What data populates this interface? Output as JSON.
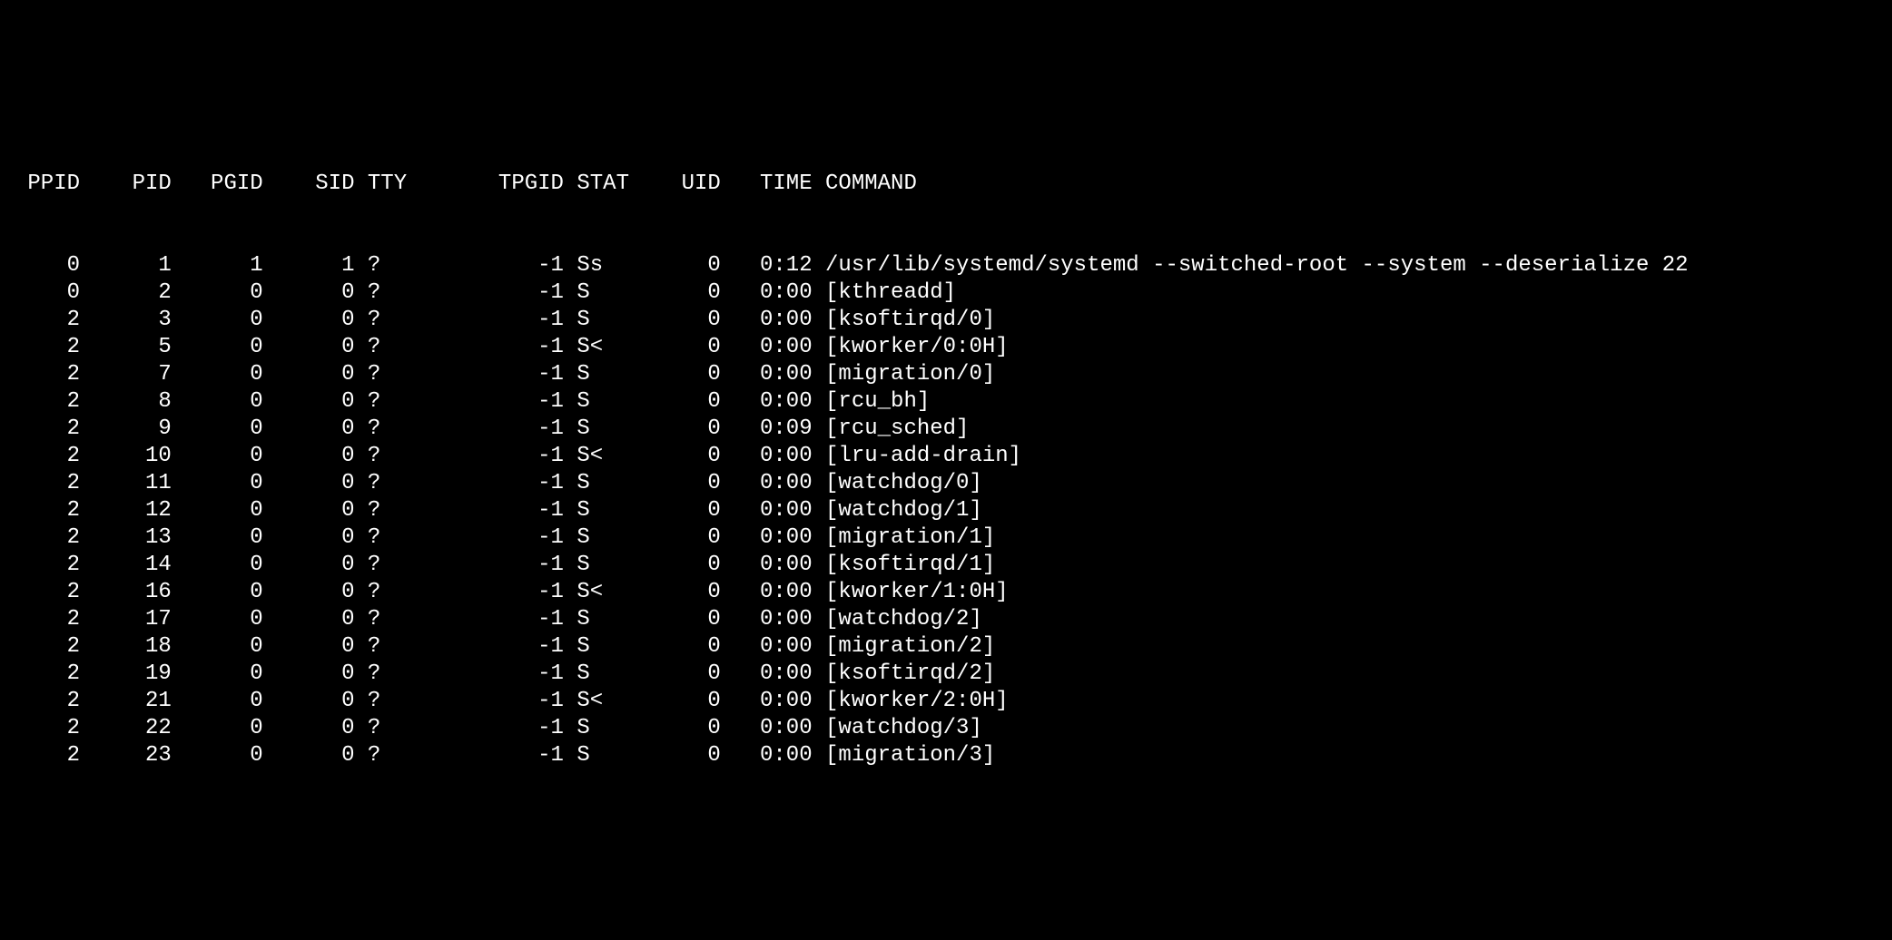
{
  "columns": {
    "ppid_w": 5,
    "pid_w": 7,
    "pgid_w": 7,
    "sid_w": 7,
    "tty_w": 4,
    "tpgid_w": 11,
    "stat_w": 5,
    "uid_w": 6,
    "time_w": 7,
    "command_w": 0
  },
  "headers": {
    "ppid": "PPID",
    "pid": "PID",
    "pgid": "PGID",
    "sid": "SID",
    "tty": "TTY",
    "tpgid": "TPGID",
    "stat": "STAT",
    "uid": "UID",
    "time": "TIME",
    "command": "COMMAND"
  },
  "rows": [
    {
      "ppid": "0",
      "pid": "1",
      "pgid": "1",
      "sid": "1",
      "tty": "?",
      "tpgid": "-1",
      "stat": "Ss",
      "uid": "0",
      "time": "0:12",
      "command": "/usr/lib/systemd/systemd --switched-root --system --deserialize 22"
    },
    {
      "ppid": "0",
      "pid": "2",
      "pgid": "0",
      "sid": "0",
      "tty": "?",
      "tpgid": "-1",
      "stat": "S",
      "uid": "0",
      "time": "0:00",
      "command": "[kthreadd]"
    },
    {
      "ppid": "2",
      "pid": "3",
      "pgid": "0",
      "sid": "0",
      "tty": "?",
      "tpgid": "-1",
      "stat": "S",
      "uid": "0",
      "time": "0:00",
      "command": "[ksoftirqd/0]"
    },
    {
      "ppid": "2",
      "pid": "5",
      "pgid": "0",
      "sid": "0",
      "tty": "?",
      "tpgid": "-1",
      "stat": "S<",
      "uid": "0",
      "time": "0:00",
      "command": "[kworker/0:0H]"
    },
    {
      "ppid": "2",
      "pid": "7",
      "pgid": "0",
      "sid": "0",
      "tty": "?",
      "tpgid": "-1",
      "stat": "S",
      "uid": "0",
      "time": "0:00",
      "command": "[migration/0]"
    },
    {
      "ppid": "2",
      "pid": "8",
      "pgid": "0",
      "sid": "0",
      "tty": "?",
      "tpgid": "-1",
      "stat": "S",
      "uid": "0",
      "time": "0:00",
      "command": "[rcu_bh]"
    },
    {
      "ppid": "2",
      "pid": "9",
      "pgid": "0",
      "sid": "0",
      "tty": "?",
      "tpgid": "-1",
      "stat": "S",
      "uid": "0",
      "time": "0:09",
      "command": "[rcu_sched]"
    },
    {
      "ppid": "2",
      "pid": "10",
      "pgid": "0",
      "sid": "0",
      "tty": "?",
      "tpgid": "-1",
      "stat": "S<",
      "uid": "0",
      "time": "0:00",
      "command": "[lru-add-drain]"
    },
    {
      "ppid": "2",
      "pid": "11",
      "pgid": "0",
      "sid": "0",
      "tty": "?",
      "tpgid": "-1",
      "stat": "S",
      "uid": "0",
      "time": "0:00",
      "command": "[watchdog/0]"
    },
    {
      "ppid": "2",
      "pid": "12",
      "pgid": "0",
      "sid": "0",
      "tty": "?",
      "tpgid": "-1",
      "stat": "S",
      "uid": "0",
      "time": "0:00",
      "command": "[watchdog/1]"
    },
    {
      "ppid": "2",
      "pid": "13",
      "pgid": "0",
      "sid": "0",
      "tty": "?",
      "tpgid": "-1",
      "stat": "S",
      "uid": "0",
      "time": "0:00",
      "command": "[migration/1]"
    },
    {
      "ppid": "2",
      "pid": "14",
      "pgid": "0",
      "sid": "0",
      "tty": "?",
      "tpgid": "-1",
      "stat": "S",
      "uid": "0",
      "time": "0:00",
      "command": "[ksoftirqd/1]"
    },
    {
      "ppid": "2",
      "pid": "16",
      "pgid": "0",
      "sid": "0",
      "tty": "?",
      "tpgid": "-1",
      "stat": "S<",
      "uid": "0",
      "time": "0:00",
      "command": "[kworker/1:0H]"
    },
    {
      "ppid": "2",
      "pid": "17",
      "pgid": "0",
      "sid": "0",
      "tty": "?",
      "tpgid": "-1",
      "stat": "S",
      "uid": "0",
      "time": "0:00",
      "command": "[watchdog/2]"
    },
    {
      "ppid": "2",
      "pid": "18",
      "pgid": "0",
      "sid": "0",
      "tty": "?",
      "tpgid": "-1",
      "stat": "S",
      "uid": "0",
      "time": "0:00",
      "command": "[migration/2]"
    },
    {
      "ppid": "2",
      "pid": "19",
      "pgid": "0",
      "sid": "0",
      "tty": "?",
      "tpgid": "-1",
      "stat": "S",
      "uid": "0",
      "time": "0:00",
      "command": "[ksoftirqd/2]"
    },
    {
      "ppid": "2",
      "pid": "21",
      "pgid": "0",
      "sid": "0",
      "tty": "?",
      "tpgid": "-1",
      "stat": "S<",
      "uid": "0",
      "time": "0:00",
      "command": "[kworker/2:0H]"
    },
    {
      "ppid": "2",
      "pid": "22",
      "pgid": "0",
      "sid": "0",
      "tty": "?",
      "tpgid": "-1",
      "stat": "S",
      "uid": "0",
      "time": "0:00",
      "command": "[watchdog/3]"
    },
    {
      "ppid": "2",
      "pid": "23",
      "pgid": "0",
      "sid": "0",
      "tty": "?",
      "tpgid": "-1",
      "stat": "S",
      "uid": "0",
      "time": "0:00",
      "command": "[migration/3]"
    }
  ]
}
